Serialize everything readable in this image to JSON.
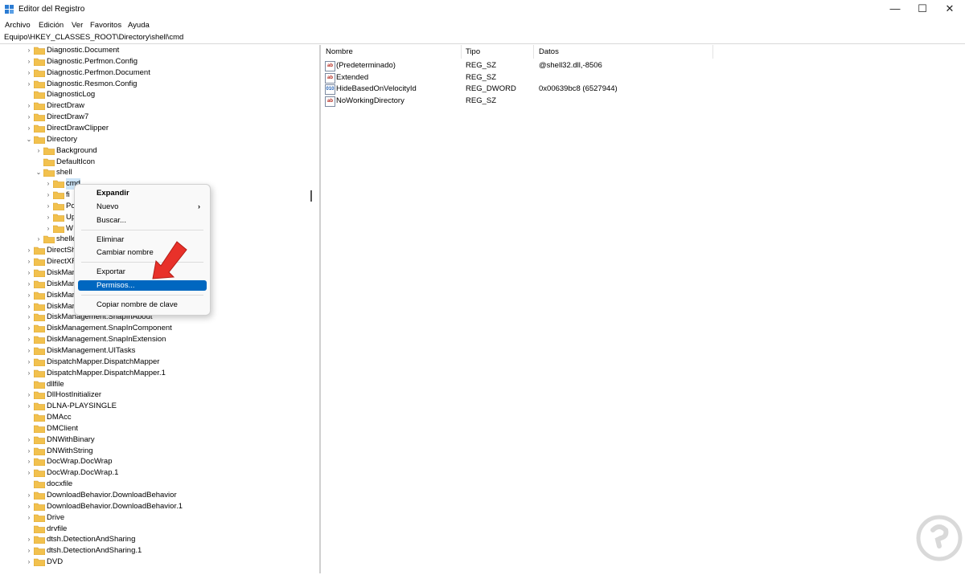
{
  "window": {
    "title": "Editor del Registro",
    "min": "—",
    "max": "☐",
    "close": "✕"
  },
  "menu": [
    "Archivo",
    "Edición",
    "Ver",
    "Favoritos",
    "Ayuda"
  ],
  "address": "Equipo\\HKEY_CLASSES_ROOT\\Directory\\shell\\cmd",
  "tree": [
    "Diagnostic.Document",
    "Diagnostic.Perfmon.Config",
    "Diagnostic.Perfmon.Document",
    "Diagnostic.Resmon.Config",
    "DiagnosticLog",
    "DirectDraw",
    "DirectDraw7",
    "DirectDrawClipper",
    "Directory",
    "Background",
    "DefaultIcon",
    "shell",
    "cmd",
    "fi",
    "Po",
    "Up",
    "W",
    "shelle",
    "DirectSh",
    "DirectXF",
    "DiskMar",
    "DiskMar",
    "DiskMar",
    "DiskMar",
    "DiskManagement.SnapInAbout",
    "DiskManagement.SnapInComponent",
    "DiskManagement.SnapInExtension",
    "DiskManagement.UITasks",
    "DispatchMapper.DispatchMapper",
    "DispatchMapper.DispatchMapper.1",
    "dllfile",
    "DllHostInitializer",
    "DLNA-PLAYSINGLE",
    "DMAcc",
    "DMClient",
    "DNWithBinary",
    "DNWithString",
    "DocWrap.DocWrap",
    "DocWrap.DocWrap.1",
    "docxfile",
    "DownloadBehavior.DownloadBehavior",
    "DownloadBehavior.DownloadBehavior.1",
    "Drive",
    "drvfile",
    "dtsh.DetectionAndSharing",
    "dtsh.DetectionAndSharing.1",
    "DVD"
  ],
  "list": {
    "headers": {
      "name": "Nombre",
      "type": "Tipo",
      "data": "Datos"
    },
    "rows": [
      {
        "name": "(Predeterminado)",
        "type": "REG_SZ",
        "data": "@shell32.dll,-8506",
        "icon": "ab"
      },
      {
        "name": "Extended",
        "type": "REG_SZ",
        "data": "",
        "icon": "ab"
      },
      {
        "name": "HideBasedOnVelocityId",
        "type": "REG_DWORD",
        "data": "0x00639bc8 (6527944)",
        "icon": "010"
      },
      {
        "name": "NoWorkingDirectory",
        "type": "REG_SZ",
        "data": "",
        "icon": "ab"
      }
    ]
  },
  "context_menu": {
    "expand": "Expandir",
    "new": "Nuevo",
    "find": "Buscar...",
    "delete": "Eliminar",
    "rename": "Cambiar nombre",
    "export": "Exportar",
    "permissions": "Permisos...",
    "copy_key": "Copiar nombre de clave"
  },
  "colors": {
    "highlight": "#0067c0",
    "folder": "#f2c14e",
    "arrow": "#e8312a"
  }
}
